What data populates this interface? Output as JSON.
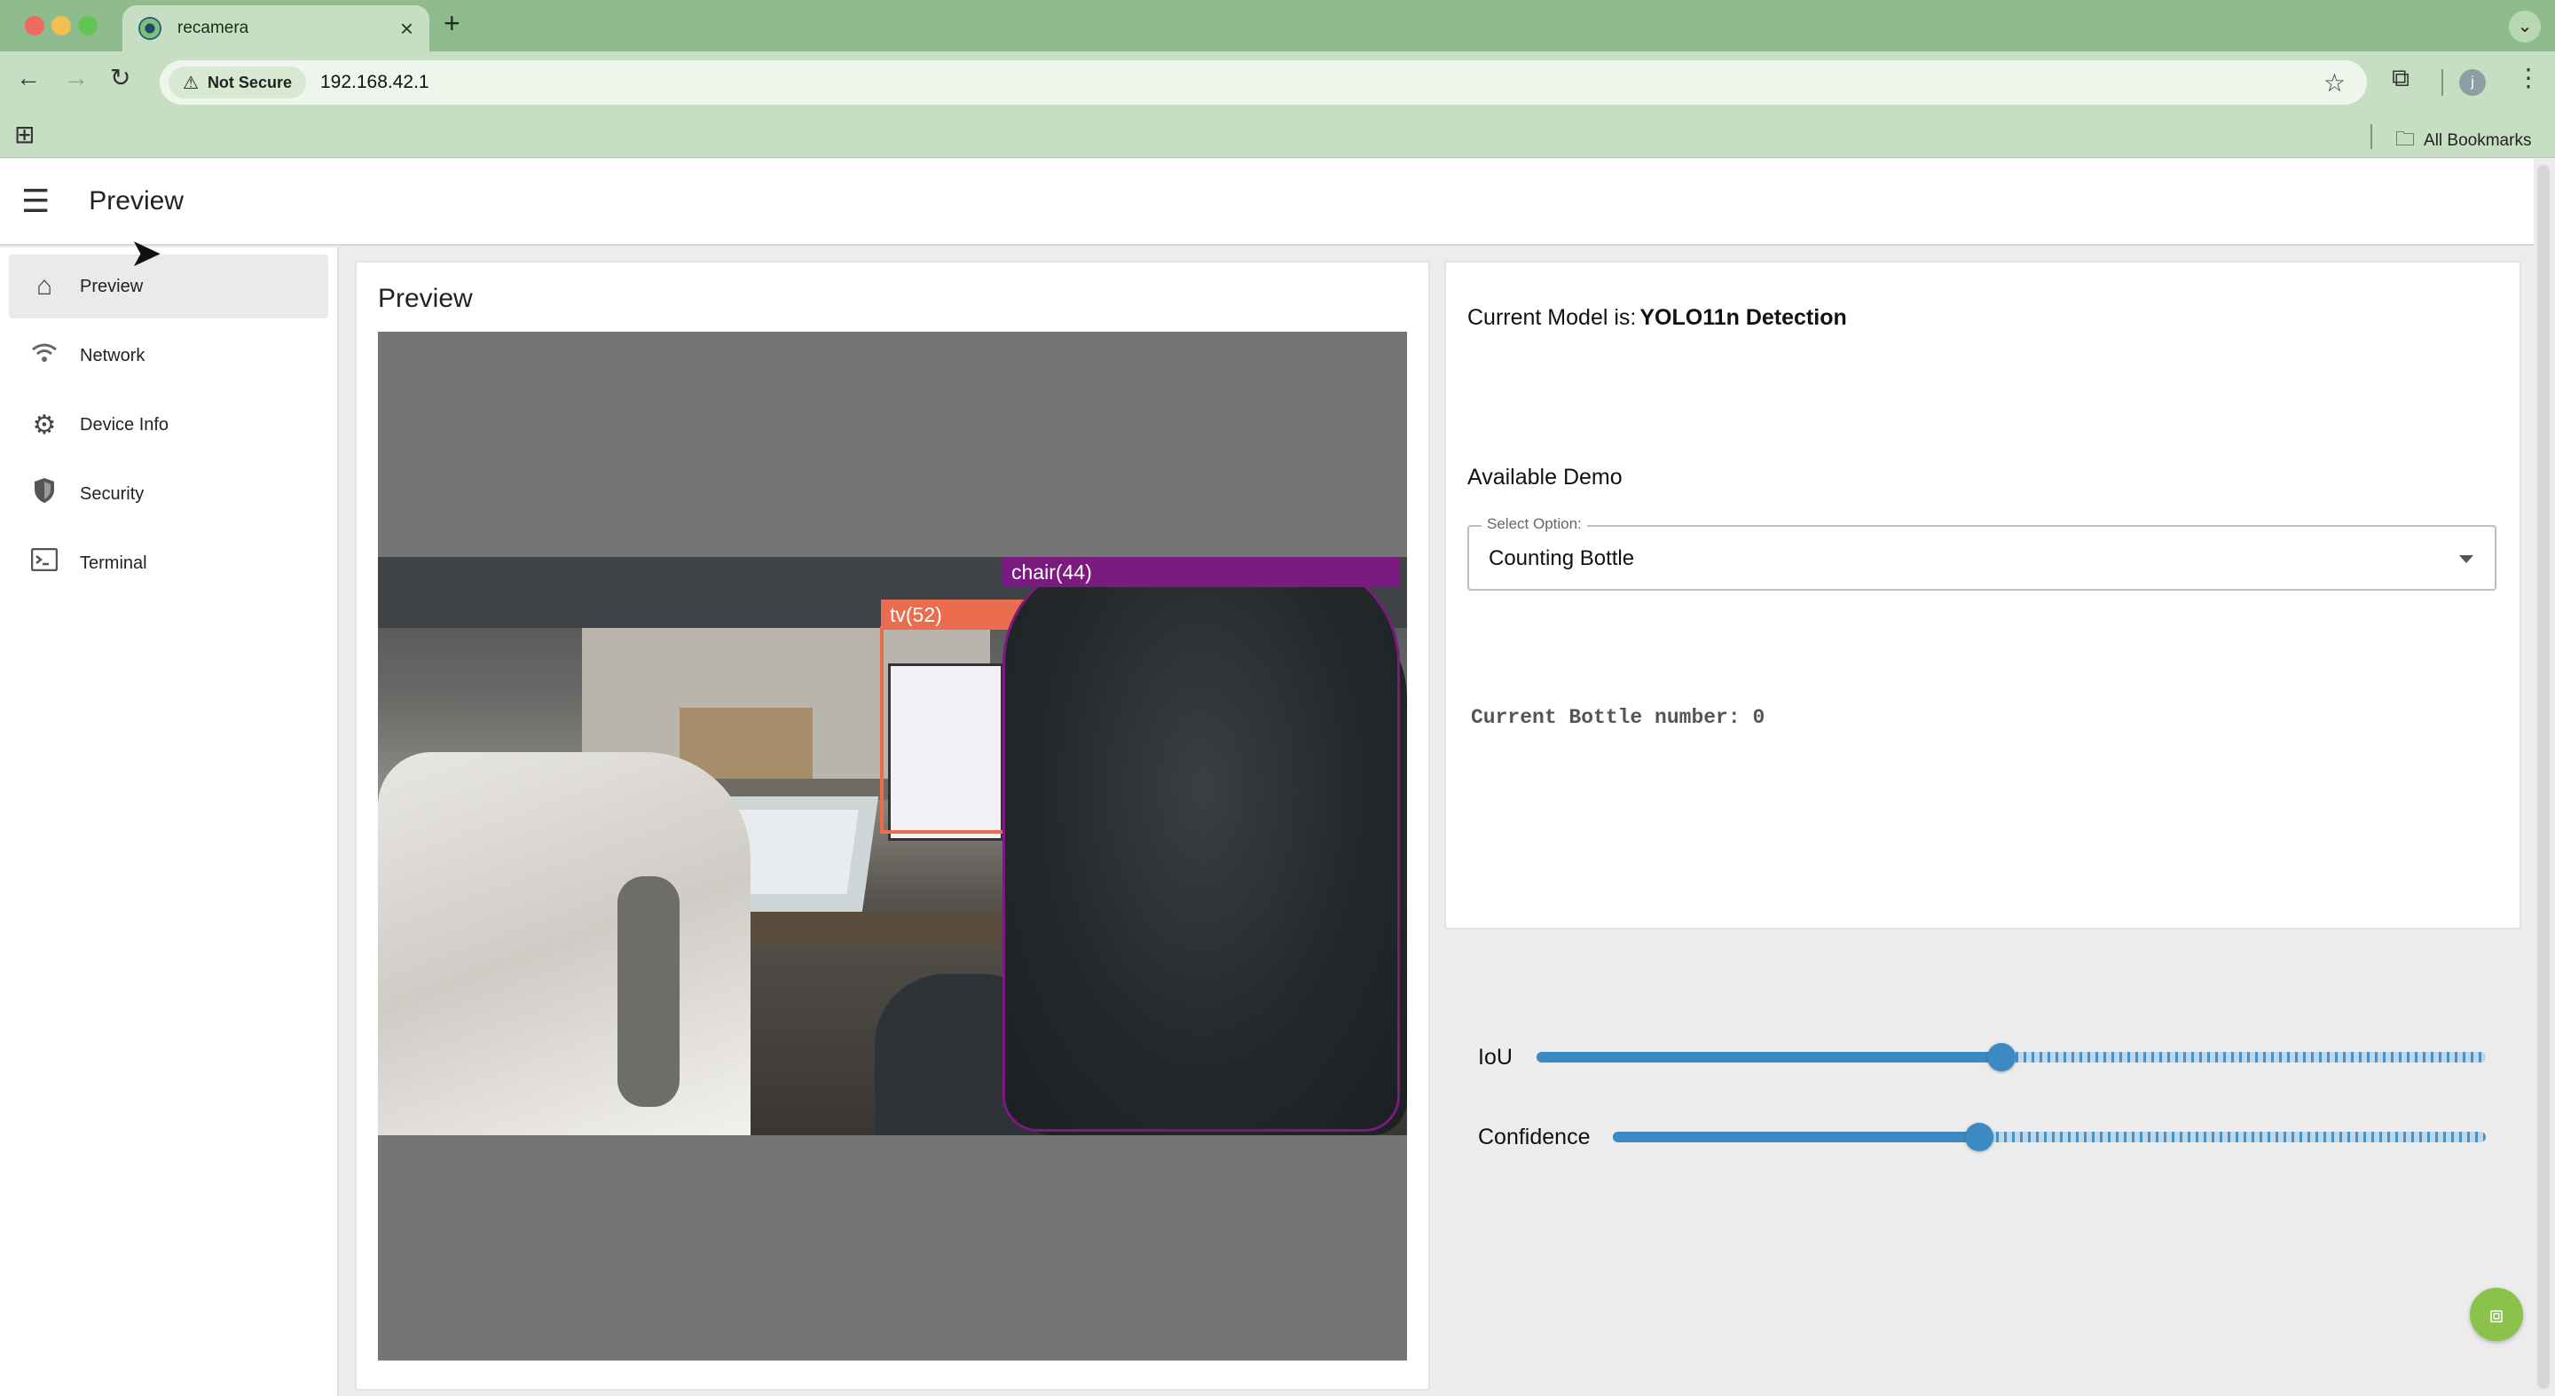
{
  "browser": {
    "tab_title": "recamera",
    "new_tab_icon": "+",
    "close_icon": "×",
    "security_label": "Not Secure",
    "url": "192.168.42.1",
    "profile_initial": "j",
    "bookmarks_label": "All Bookmarks"
  },
  "header": {
    "title": "Preview"
  },
  "sidebar": {
    "items": [
      {
        "label": "Preview",
        "icon": "home-icon"
      },
      {
        "label": "Network",
        "icon": "wifi-icon"
      },
      {
        "label": "Device Info",
        "icon": "gear-icon"
      },
      {
        "label": "Security",
        "icon": "shield-icon"
      },
      {
        "label": "Terminal",
        "icon": "terminal-icon"
      }
    ]
  },
  "preview": {
    "title": "Preview",
    "detections": [
      {
        "label": "tv(52)",
        "color": "#ea6d4f"
      },
      {
        "label": "chair(44)",
        "color": "#7b1a7f"
      }
    ]
  },
  "panel": {
    "model_prefix": "Current Model is:",
    "model_name": "YOLO11n Detection",
    "available_demo": "Available Demo",
    "select_legend": "Select Option:",
    "select_value": "Counting Bottle",
    "bottle_count_text": "Current Bottle number: 0",
    "sliders": {
      "iou": {
        "label": "IoU",
        "value": 0.49
      },
      "confidence": {
        "label": "Confidence",
        "value": 0.42
      }
    }
  },
  "colors": {
    "accent": "#3c8ac3",
    "browser_frame": "#8fbc8f",
    "fab": "#8bc34a"
  }
}
